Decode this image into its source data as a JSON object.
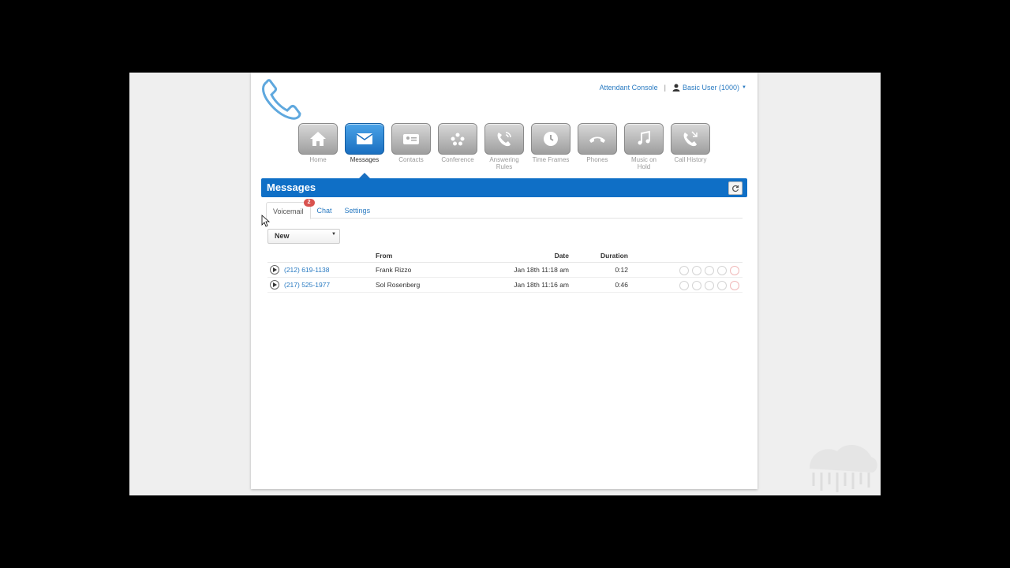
{
  "header": {
    "attendant_console": "Attendant Console",
    "separator": "|",
    "user_label": "Basic User (1000)"
  },
  "nav": {
    "items": [
      {
        "label": "Home",
        "icon": "home-icon"
      },
      {
        "label": "Messages",
        "icon": "envelope-icon"
      },
      {
        "label": "Contacts",
        "icon": "contact-card-icon"
      },
      {
        "label": "Conference",
        "icon": "conference-icon"
      },
      {
        "label": "Answering Rules",
        "icon": "answering-rules-icon"
      },
      {
        "label": "Time Frames",
        "icon": "clock-icon"
      },
      {
        "label": "Phones",
        "icon": "handset-icon"
      },
      {
        "label": "Music on Hold",
        "icon": "music-note-icon"
      },
      {
        "label": "Call History",
        "icon": "call-history-icon"
      }
    ],
    "active": "Messages"
  },
  "panel": {
    "title": "Messages"
  },
  "tabs": [
    {
      "label": "Voicemail",
      "badge": "2"
    },
    {
      "label": "Chat"
    },
    {
      "label": "Settings"
    }
  ],
  "filter": {
    "selected": "New"
  },
  "table": {
    "headers": {
      "from": "From",
      "date": "Date",
      "duration": "Duration"
    },
    "rows": [
      {
        "number": "(212) 619-1138",
        "from": "Frank Rizzo",
        "date": "Jan 18th 11:18 am",
        "duration": "0:12"
      },
      {
        "number": "(217) 525-1977",
        "from": "Sol Rosenberg",
        "date": "Jan 18th 11:16 am",
        "duration": "0:46"
      }
    ]
  },
  "colors": {
    "accent": "#0f6fc6",
    "link": "#2a7bc2",
    "badge": "#d9534f"
  }
}
